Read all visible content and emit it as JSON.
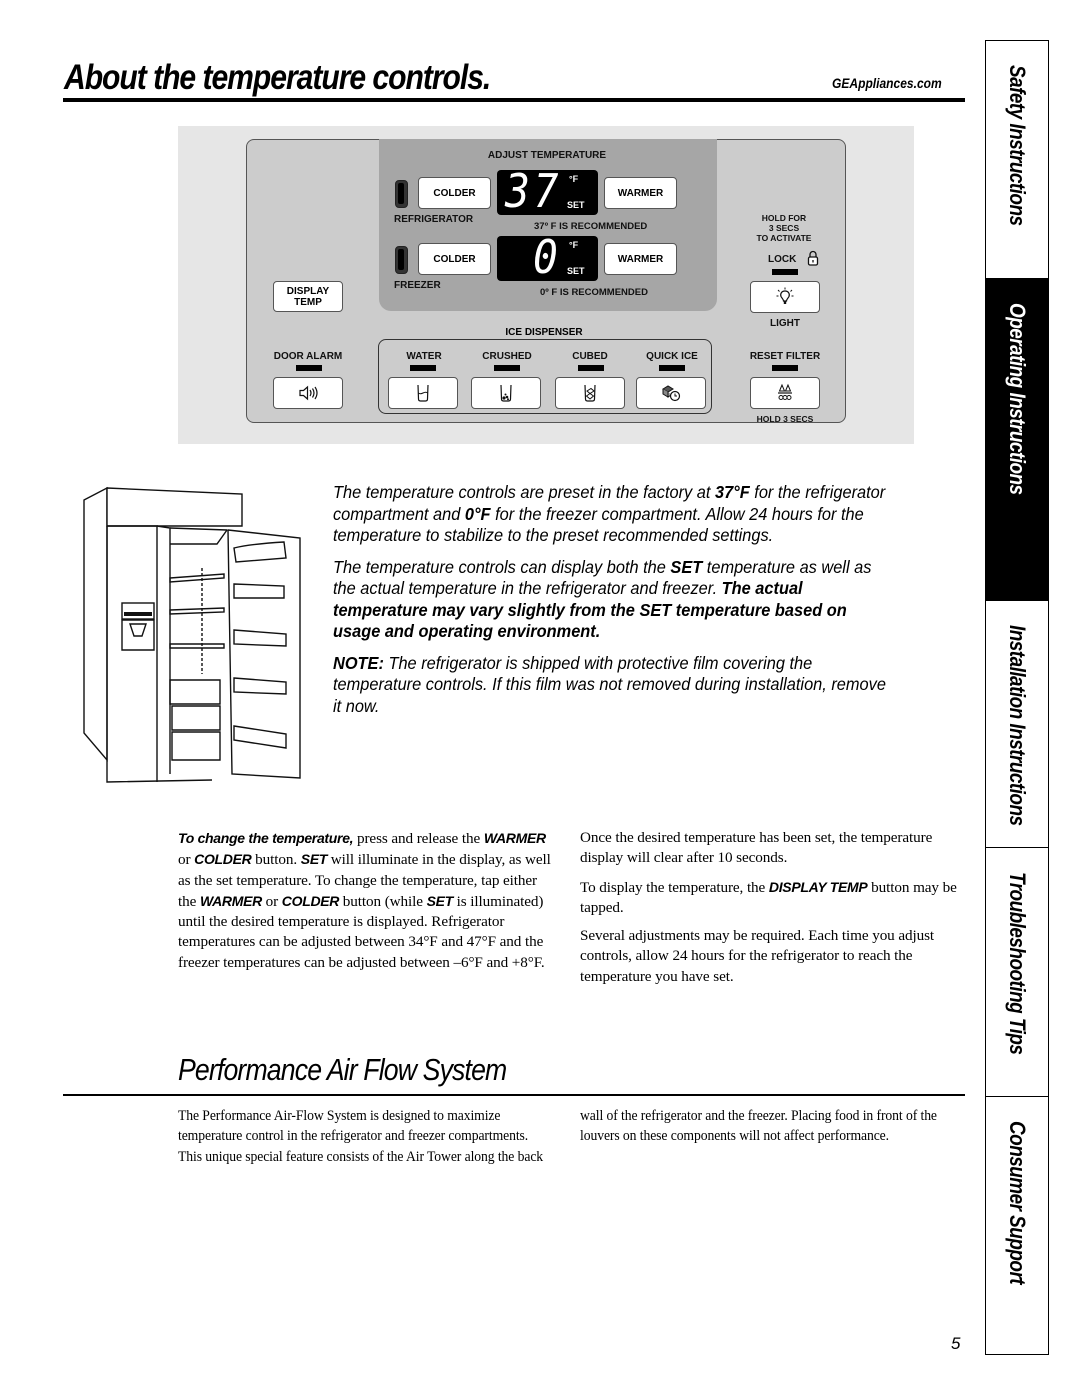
{
  "header": {
    "title": "About the temperature controls.",
    "site": "GEAppliances.com"
  },
  "panel": {
    "adjust_title": "ADJUST TEMPERATURE",
    "refrigerator": {
      "label": "REFRIGERATOR",
      "colder": "COLDER",
      "warmer": "WARMER",
      "display_value": "37",
      "unit": "°F",
      "set": "SET",
      "recommended": "37º F IS RECOMMENDED"
    },
    "freezer": {
      "label": "FREEZER",
      "colder": "COLDER",
      "warmer": "WARMER",
      "display_value": "0",
      "unit": "°F",
      "set": "SET",
      "recommended": "0º F IS RECOMMENDED"
    },
    "display_temp": "DISPLAY\nTEMP",
    "lock": {
      "hint_line1": "HOLD FOR",
      "hint_line2": "3 SECS",
      "hint_line3": "TO ACTIVATE",
      "label": "LOCK",
      "icon": "padlock-icon"
    },
    "light": {
      "label": "LIGHT",
      "icon": "lightbulb-icon"
    },
    "door_alarm": {
      "label": "DOOR ALARM",
      "icon": "speaker-icon"
    },
    "ice_dispenser": {
      "title": "ICE DISPENSER",
      "options": [
        {
          "label": "WATER",
          "icon": "water-glass-icon"
        },
        {
          "label": "CRUSHED",
          "icon": "crushed-ice-glass-icon"
        },
        {
          "label": "CUBED",
          "icon": "cubed-ice-glass-icon"
        },
        {
          "label": "QUICK ICE",
          "icon": "quick-ice-clock-icon"
        }
      ]
    },
    "reset_filter": {
      "label": "RESET FILTER",
      "hint": "HOLD 3 SECS",
      "icon": "water-drops-icon"
    }
  },
  "intro": {
    "p1_a": "The temperature controls are preset in the factory at ",
    "p1_b": "37°F",
    "p1_c": " for the refrigerator compartment and ",
    "p1_d": "0°F",
    "p1_e": " for the freezer compartment. Allow 24 hours for the temperature to stabilize to the preset recommended settings.",
    "p2_a": "The temperature controls can display both the ",
    "p2_b": "SET",
    "p2_c": " temperature as well as the actual temperature in the refrigerator and freezer. ",
    "p2_d": "The actual temperature may vary slightly from the SET temperature based on usage and operating environment.",
    "p3_a": "NOTE:",
    "p3_b": " The refrigerator is shipped with protective film covering the temperature controls. If this film was not removed during installation, remove it now."
  },
  "change_temp": {
    "lead": "To change the temperature,",
    "t1": " press and release the ",
    "warmer": "WARMER",
    "t2": " or ",
    "colder": "COLDER",
    "t3": " button. ",
    "set": "SET",
    "t4": " will illuminate in the display, as well as the set temperature. To change the temperature, tap either the ",
    "warmer2": "WARMER",
    "t5": " or ",
    "colder2": "COLDER",
    "t6": " button (while ",
    "set2": "SET",
    "t7": " is illuminated) until the desired temperature is displayed. Refrigerator temperatures can be adjusted between 34°F and 47°F and the freezer temperatures can be adjusted between –6°F and +8°F."
  },
  "right_col": {
    "p1": "Once the desired temperature has been set, the temperature display will clear after 10 seconds.",
    "p2_a": "To display the temperature, the ",
    "p2_b": "DISPLAY TEMP",
    "p2_c": " button may be tapped.",
    "p3": "Several adjustments may be required. Each time you adjust controls, allow 24 hours for the refrigerator to reach the temperature you have set."
  },
  "airflow": {
    "title": "Performance Air Flow System",
    "left": "The Performance Air-Flow System is designed to maximize temperature control in the refrigerator and freezer compartments. This unique special feature consists of the Air Tower along the back",
    "right": "wall of the refrigerator and the freezer. Placing food in front of the louvers on these components will not affect performance."
  },
  "tabs": [
    {
      "label": "Safety Instructions",
      "active": false
    },
    {
      "label": "Operating Instructions",
      "active": true
    },
    {
      "label": "Installation Instructions",
      "active": false
    },
    {
      "label": "Troubleshooting Tips",
      "active": false
    },
    {
      "label": "Consumer Support",
      "active": false
    }
  ],
  "page_number": "5"
}
